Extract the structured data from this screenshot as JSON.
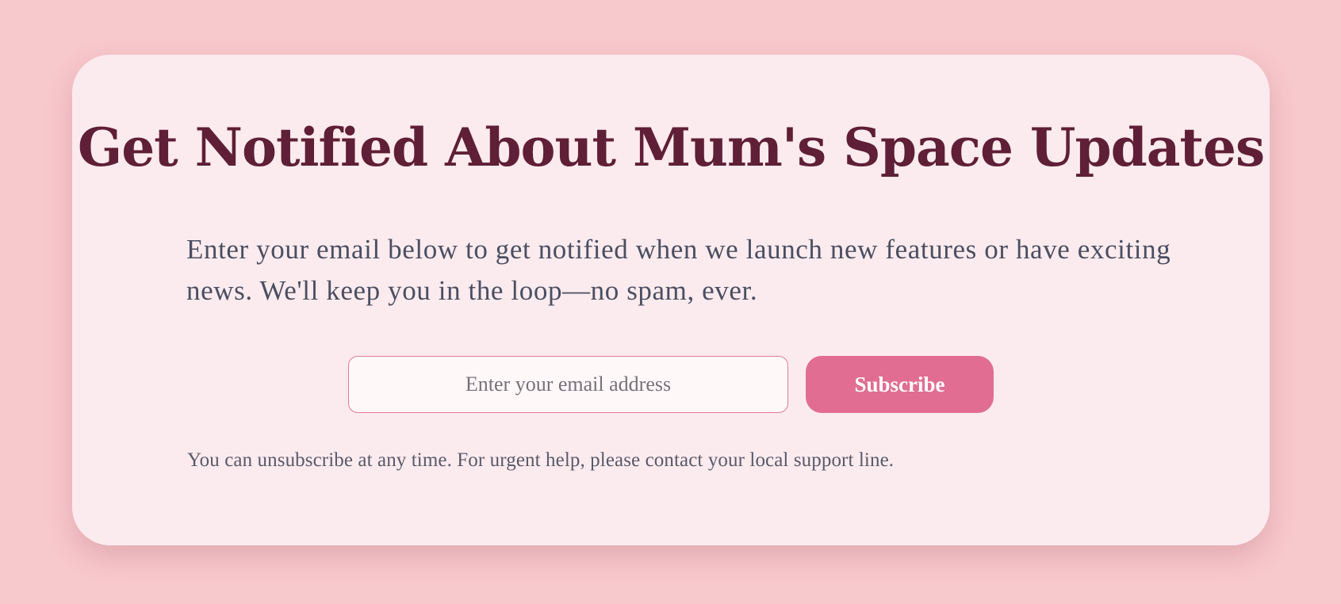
{
  "header": {
    "title": "Get Notified About Mum's Space Updates"
  },
  "intro": {
    "text": "Enter your email below to get notified when we launch new features or have exciting news. We'll keep you in the loop—no spam, ever."
  },
  "form": {
    "email_placeholder": "Enter your email address",
    "email_value": "",
    "subscribe_label": "Subscribe"
  },
  "footer": {
    "note": "You can unsubscribe at any time. For urgent help, please contact your local support line."
  },
  "colors": {
    "page_background": "#f7c8cc",
    "card_background": "#fcebee",
    "title": "#5f1f36",
    "body_text": "#4a4f62",
    "accent": "#e16d92",
    "input_border": "#e07b9e"
  }
}
